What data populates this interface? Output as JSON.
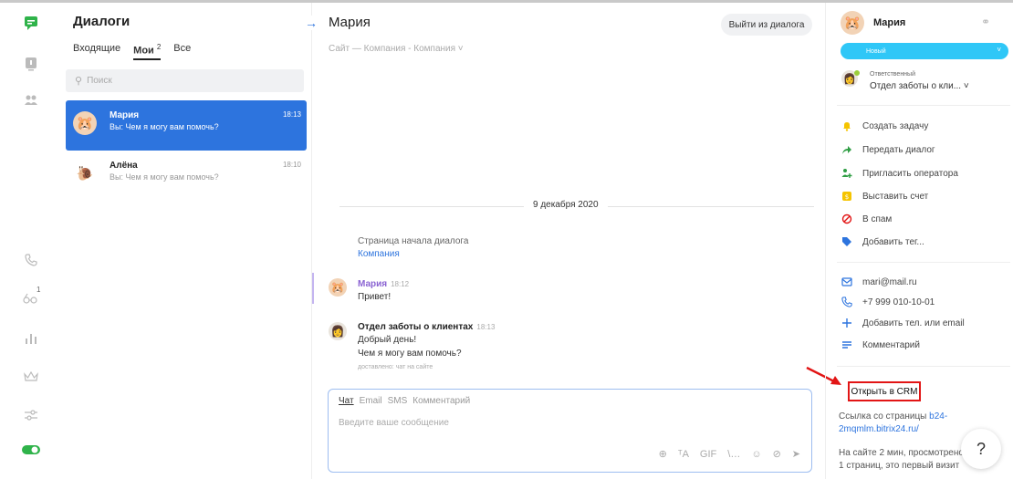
{
  "rail": {
    "badge_count": "1"
  },
  "list": {
    "title": "Диалоги",
    "tabs": [
      {
        "label": "Входящие",
        "count": ""
      },
      {
        "label": "Мои",
        "count": "2"
      },
      {
        "label": "Все",
        "count": ""
      }
    ],
    "search_placeholder": "Поиск",
    "dialogs": [
      {
        "name": "Мария",
        "message": "Вы: Чем я могу вам помочь?",
        "time": "18:13",
        "avatar": "hamster-avatar"
      },
      {
        "name": "Алёна",
        "message": "Вы: Чем я могу вам помочь?",
        "time": "18:10",
        "avatar": "snail-avatar"
      }
    ]
  },
  "chat": {
    "title": "Мария",
    "leave_button": "Выйти из диалога",
    "subtitle": "Сайт — Компания - Компания ˅",
    "date_divider": "9 декабря 2020",
    "system_line1": "Страница начала диалога",
    "system_line2": "Компания",
    "messages": [
      {
        "author": "Мария",
        "time": "18:12",
        "lines": [
          "Привет!"
        ],
        "status": ""
      },
      {
        "author": "Отдел заботы о клиентах",
        "time": "18:13",
        "lines": [
          "Добрый день!",
          "Чем я могу вам помочь?"
        ],
        "status": "доставлено: чат на сайте"
      }
    ],
    "composer": {
      "tabs": [
        "Чат",
        "Email",
        "SMS",
        "Комментарий"
      ],
      "placeholder": "Введите ваше сообщение",
      "gif_label": "GIF"
    }
  },
  "panel": {
    "name": "Мария",
    "status": "Новый",
    "responsible_label": "Ответственный",
    "responsible_value": "Отдел заботы о кли... ˅",
    "actions": [
      {
        "label": "Создать задачу",
        "icon": "bell-icon",
        "color": "#f5c400"
      },
      {
        "label": "Передать диалог",
        "icon": "forward-arrow-icon",
        "color": "#2f9e44"
      },
      {
        "label": "Пригласить оператора",
        "icon": "add-user-icon",
        "color": "#2f9e44"
      },
      {
        "label": "Выставить счет",
        "icon": "invoice-icon",
        "color": "#f5c400"
      },
      {
        "label": "В спам",
        "icon": "spam-icon",
        "color": "#e21515"
      },
      {
        "label": "Добавить тег...",
        "icon": "tag-icon",
        "color": "#2d74de"
      }
    ],
    "contacts": [
      {
        "label": "mari@mail.ru",
        "icon": "mail-icon"
      },
      {
        "label": "+7 999 010-10-01",
        "icon": "phone-icon"
      },
      {
        "label": "Добавить тел. или email",
        "icon": "plus-icon"
      },
      {
        "label": "Комментарий",
        "icon": "comment-icon"
      }
    ],
    "crm_button": "Открыть в CRM",
    "note1_prefix": "Ссылка со страницы ",
    "note1_link": "b24-2mqmlm.bitrix24.ru/",
    "note2": "На сайте 2 мин, просмотрено 1 страниц, это первый визит"
  },
  "colors": {
    "accent": "#2d74de",
    "status_new": "#2fc7f7",
    "highlight_red": "#e21515"
  }
}
